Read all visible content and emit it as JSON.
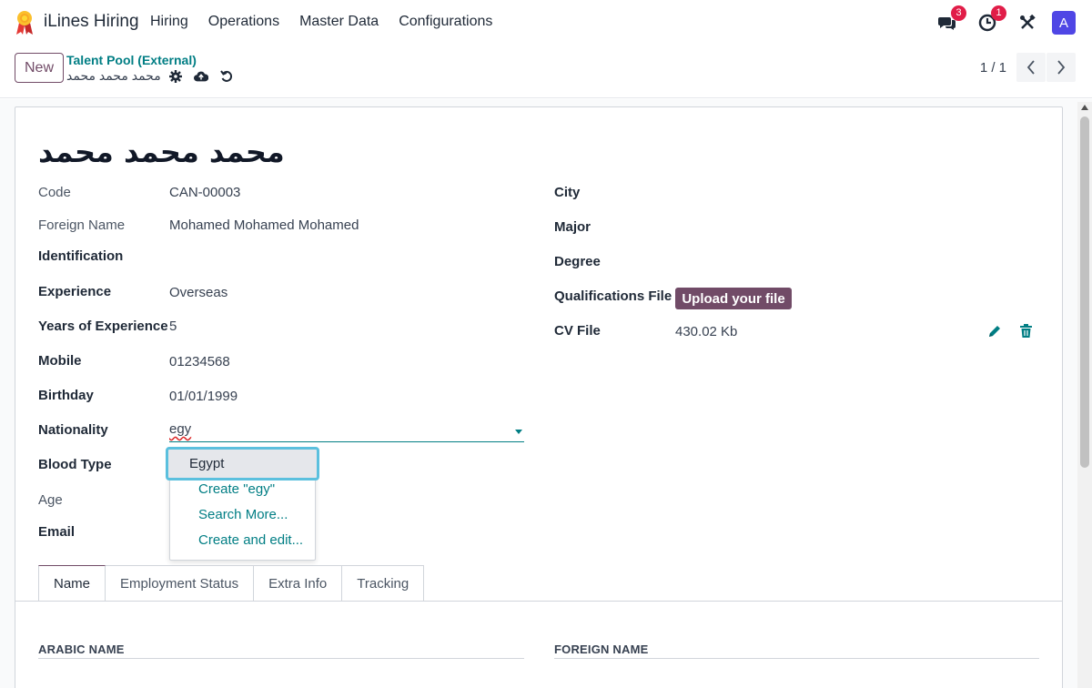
{
  "app": {
    "name": "iLines Hiring",
    "menu": [
      "Hiring",
      "Operations",
      "Master Data",
      "Configurations"
    ],
    "badges": {
      "messages": "3",
      "activities": "1"
    },
    "avatar_letter": "A"
  },
  "control_panel": {
    "new_label": "New",
    "breadcrumb": "Talent Pool (External)",
    "record_name": "محمد محمد محمد",
    "pager": "1 / 1"
  },
  "form": {
    "title": "محمد محمد محمد",
    "left_fields": [
      {
        "label": "Code",
        "value": "CAN-00003"
      },
      {
        "label": "Foreign Name",
        "value": "Mohamed Mohamed Mohamed"
      },
      {
        "label": "Identification",
        "value": ""
      },
      {
        "label": "Experience",
        "value": "Overseas"
      },
      {
        "label": "Years of Experience",
        "value": "5"
      },
      {
        "label": "Mobile",
        "value": "01234568"
      },
      {
        "label": "Birthday",
        "value": "01/01/1999"
      },
      {
        "label": "Nationality",
        "value": "egy"
      },
      {
        "label": "Blood Type",
        "value": ""
      },
      {
        "label": "Age",
        "value": ""
      },
      {
        "label": "Email",
        "value": ""
      }
    ],
    "right_fields": [
      {
        "label": "City",
        "value": ""
      },
      {
        "label": "Major",
        "value": ""
      },
      {
        "label": "Degree",
        "value": ""
      },
      {
        "label": "Qualifications File",
        "value": ""
      },
      {
        "label": "CV File",
        "value": "430.02 Kb"
      }
    ],
    "upload_label": "Upload your file",
    "dropdown": {
      "selected": "Egypt",
      "options": [
        "Create \"egy\"",
        "Search More...",
        "Create and edit..."
      ]
    },
    "tabs": [
      "Name",
      "Employment Status",
      "Extra Info",
      "Tracking"
    ],
    "sections": {
      "arabic_name": "ARABIC NAME",
      "foreign_name": "FOREIGN NAME"
    }
  },
  "colors": {
    "brand": "#714b67",
    "accent": "#017e84",
    "badge": "#e11d48",
    "avatar": "#4f46e5"
  }
}
